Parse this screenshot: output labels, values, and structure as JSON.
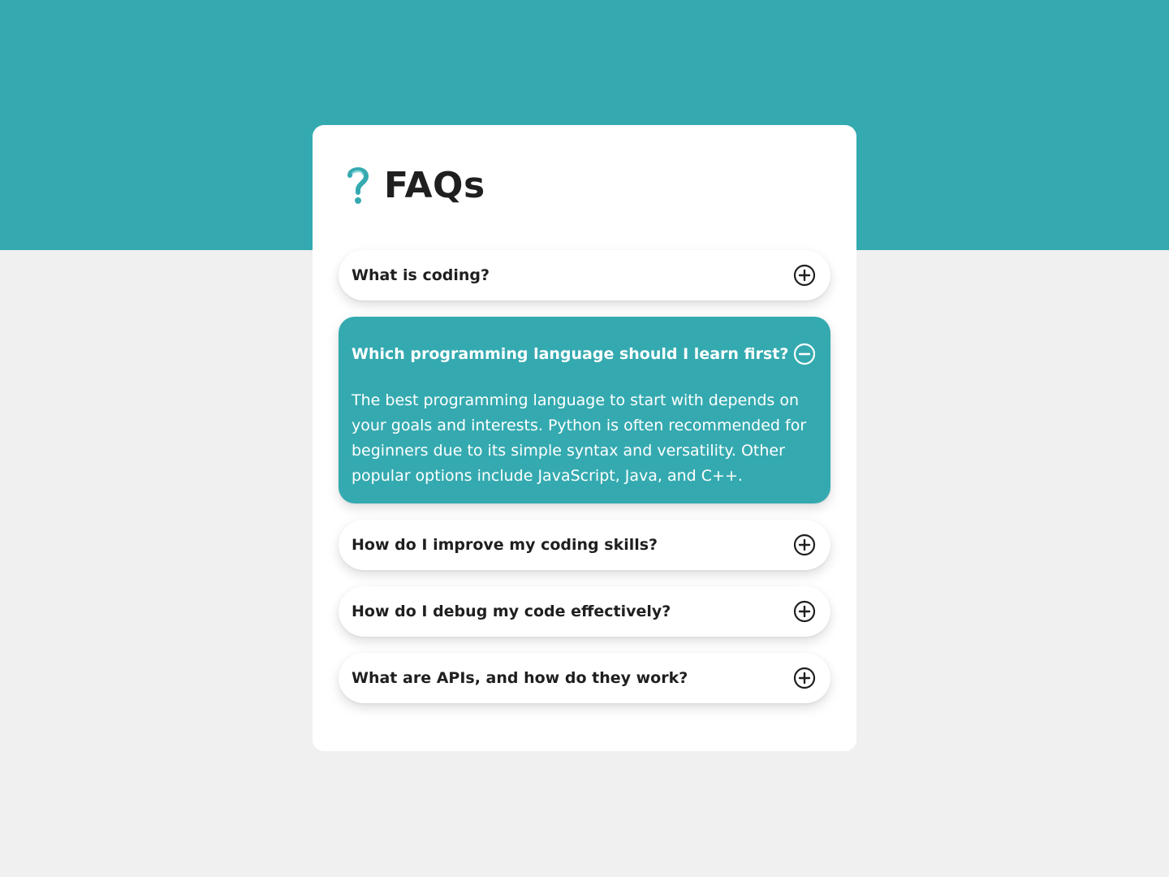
{
  "page": {
    "title": "FAQs",
    "header_icon": "question-mark-icon"
  },
  "colors": {
    "accent": "#34aab0",
    "background": "#f0f0f0",
    "card": "#ffffff",
    "text": "#1f1f1f"
  },
  "faqs": [
    {
      "question": "What is coding?",
      "expanded": false,
      "icon": "plus-circle-icon"
    },
    {
      "question": "Which programming language should I learn first?",
      "expanded": true,
      "icon": "minus-circle-icon",
      "answer": "The best programming language to start with depends on your goals and interests. Python is often recommended for beginners due to its simple syntax and versatility. Other popular options include JavaScript, Java, and C++."
    },
    {
      "question": "How do I improve my coding skills?",
      "expanded": false,
      "icon": "plus-circle-icon"
    },
    {
      "question": "How do I debug my code effectively?",
      "expanded": false,
      "icon": "plus-circle-icon"
    },
    {
      "question": "What are APIs, and how do they work?",
      "expanded": false,
      "icon": "plus-circle-icon"
    }
  ]
}
